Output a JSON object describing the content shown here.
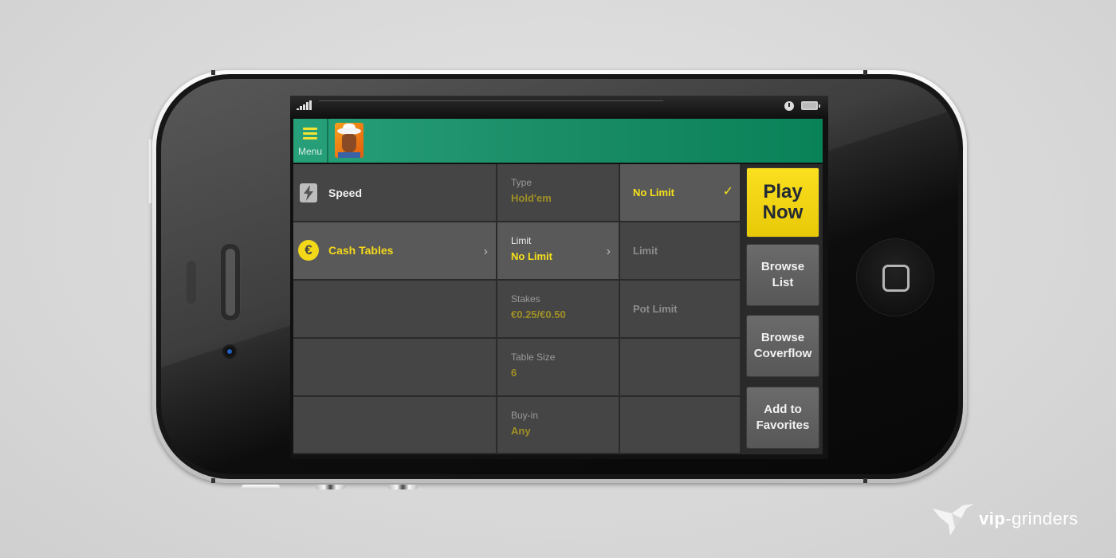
{
  "status_bar": {
    "signal_icon": "signal-bars-icon",
    "clock_icon": "clock-icon",
    "battery_icon": "battery-icon"
  },
  "app_bar": {
    "menu_label": "Menu",
    "menu_icon": "hamburger-icon",
    "avatar": "cowboy-avatar"
  },
  "categories": [
    {
      "label": "Speed",
      "icon": "lightning-icon",
      "active": false
    },
    {
      "label": "Cash Tables",
      "icon": "euro-coin-icon",
      "active": true
    }
  ],
  "filters": [
    {
      "label": "Type",
      "value": "Hold'em",
      "active": false
    },
    {
      "label": "Limit",
      "value": "No Limit",
      "active": true
    },
    {
      "label": "Stakes",
      "value": "€0.25/€0.50",
      "active": false
    },
    {
      "label": "Table Size",
      "value": "6",
      "active": false
    },
    {
      "label": "Buy-in",
      "value": "Any",
      "active": false
    }
  ],
  "limit_options": [
    {
      "label": "No Limit",
      "selected": true
    },
    {
      "label": "Limit",
      "selected": false
    },
    {
      "label": "Pot Limit",
      "selected": false
    }
  ],
  "actions": {
    "play_now": "Play Now",
    "browse_list": "Browse List",
    "browse_coverflow": "Browse Coverflow",
    "add_favorites": "Add to Favorites"
  },
  "colors": {
    "app_bar": "#1a8c66",
    "accent_yellow": "#f6e01b",
    "cell_bg": "#454545"
  },
  "watermark": {
    "brand_bold": "vip",
    "brand_rest": "-grinders"
  }
}
